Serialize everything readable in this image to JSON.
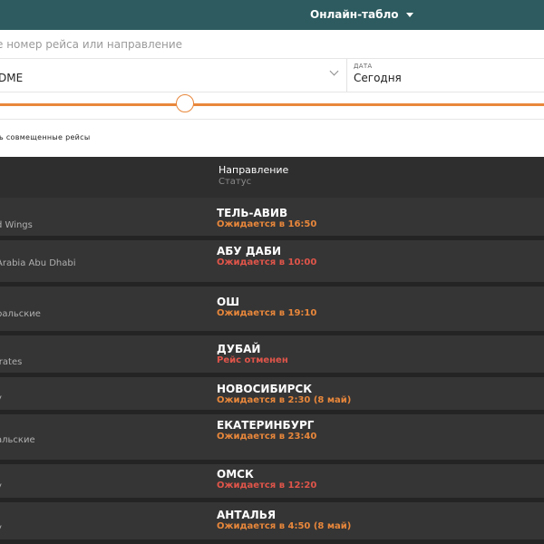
{
  "header": {
    "menu_label": "Онлайн-табло"
  },
  "search": {
    "placeholder": "е номер рейса или направление"
  },
  "filters": {
    "airport_value": "DME",
    "date_label": "ДАТА",
    "date_value": "Сегодня"
  },
  "toggle": {
    "combined_label": "ть совмещенные рейсы"
  },
  "table": {
    "header_destination": "Направление",
    "header_status": "Статус",
    "rows": [
      {
        "airline": "d Wings",
        "destination": "ТЕЛЬ-АВИВ",
        "status": "Ожидается в 16:50",
        "status_color": "#e8873b"
      },
      {
        "airline": "Arabia Abu Dhabi",
        "destination": "АБУ ДАБИ",
        "status": "Ожидается в 10:00",
        "status_color": "#e0554a"
      },
      {
        "airline": "ральские",
        "destination": "ОШ",
        "status": "Ожидается в 19:10",
        "status_color": "#e8873b"
      },
      {
        "airline": "irates",
        "destination": "ДУБАЙ",
        "status": "Рейс отменен",
        "status_color": "#e0554a"
      },
      {
        "airline": "y",
        "destination": "НОВОСИБИРСК",
        "status": "Ожидается в 2:30 (8 май)",
        "status_color": "#e8873b"
      },
      {
        "airline": "альские",
        "destination": "ЕКАТЕРИНБУРГ",
        "status": "Ожидается в 23:40",
        "status_color": "#e8873b"
      },
      {
        "airline": "y",
        "destination": "ОМСК",
        "status": "Ожидается в 12:20",
        "status_color": "#e0554a"
      },
      {
        "airline": "y",
        "destination": "АНТАЛЬЯ",
        "status": "Ожидается в 4:50 (8 май)",
        "status_color": "#e8873b"
      }
    ]
  },
  "colors": {
    "header_bg": "#2d5b5f",
    "accent_orange": "#e8873b",
    "accent_red": "#e0554a"
  }
}
